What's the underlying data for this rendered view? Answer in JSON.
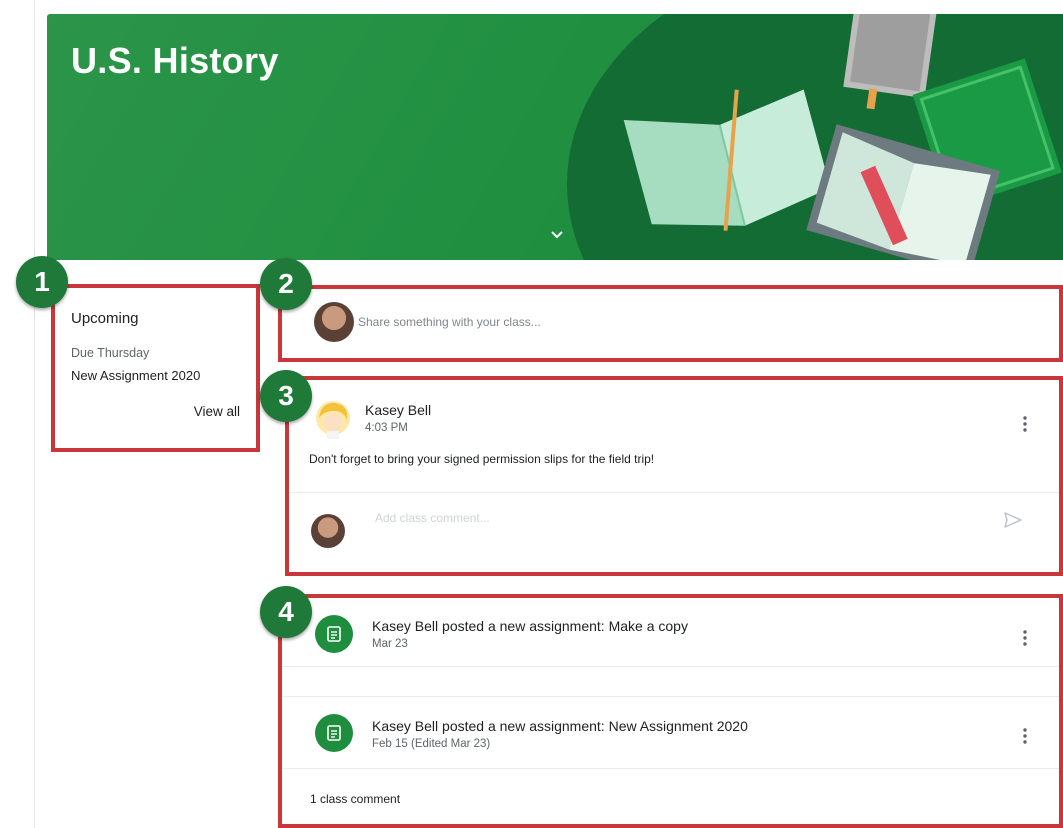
{
  "course": {
    "title": "U.S. History"
  },
  "callouts": [
    "1",
    "2",
    "3",
    "4"
  ],
  "upcoming": {
    "title": "Upcoming",
    "due_label": "Due Thursday",
    "item": "New Assignment 2020",
    "view_all": "View all"
  },
  "share": {
    "placeholder": "Share something with your class..."
  },
  "announcement": {
    "author": "Kasey Bell",
    "time": "4:03 PM",
    "body": "Don't forget to bring your signed permission slips for the field trip!",
    "comment_placeholder": "Add class comment..."
  },
  "assignments": [
    {
      "title": "Kasey Bell posted a new assignment: Make a copy",
      "date": "Mar 23"
    },
    {
      "title": "Kasey Bell posted a new assignment: New Assignment 2020",
      "date": "Feb 15 (Edited Mar 23)",
      "comments": "1 class comment"
    }
  ],
  "icons": {
    "avatar": "user-avatar",
    "author_avatar": "author-avatar",
    "more": "more-vert-icon",
    "send": "send-icon",
    "assignment": "assignment-icon",
    "expand": "chevron-down-icon"
  },
  "colors": {
    "banner": "#1e8e3e",
    "callout": "#1f7a3a",
    "highlight": "#c9373a"
  }
}
